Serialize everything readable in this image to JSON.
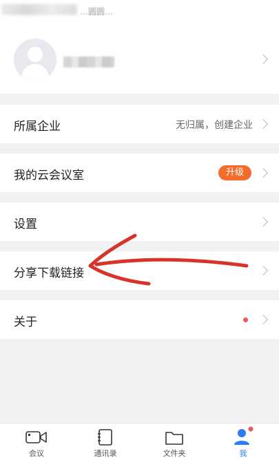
{
  "top_status": {
    "text": "…圆圆…"
  },
  "rows": [
    {
      "label": "所属企业",
      "value": "无归属，创建企业"
    },
    {
      "label": "我的云会议室",
      "badge": "升级"
    },
    {
      "label": "设置"
    },
    {
      "label": "分享下载链接"
    },
    {
      "label": "关于"
    }
  ],
  "tabs": [
    {
      "label": "会议",
      "icon": "video-camera-icon"
    },
    {
      "label": "通讯录",
      "icon": "contacts-icon"
    },
    {
      "label": "文件夹",
      "icon": "folder-icon"
    },
    {
      "label": "我",
      "icon": "person-icon",
      "active": true
    }
  ],
  "colors": {
    "accent": "#2d7cf6",
    "badge": "#f56c2a",
    "notification_dot": "#f0555e",
    "annotation_arrow": "#d8322b"
  }
}
